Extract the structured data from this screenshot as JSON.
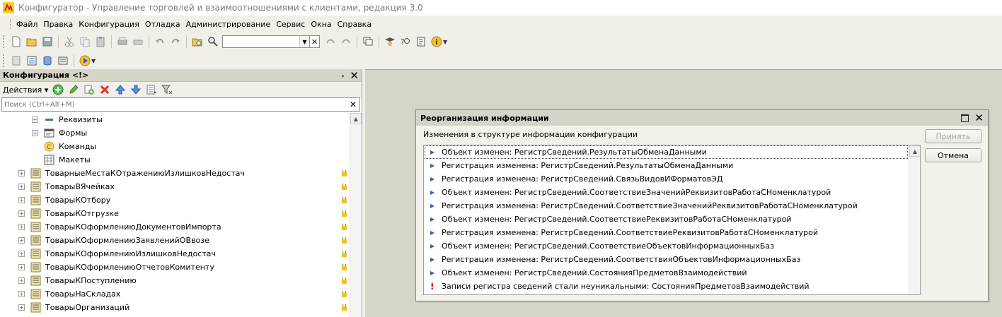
{
  "window": {
    "title": "Конфигуратор - Управление торговлей и взаимоотношениями с клиентами, редакция 3.0"
  },
  "menu": {
    "items": [
      "Файл",
      "Правка",
      "Конфигурация",
      "Отладка",
      "Администрирование",
      "Сервис",
      "Окна",
      "Справка"
    ]
  },
  "config_panel": {
    "title": "Конфигурация <!>",
    "actions_label": "Действия",
    "search_placeholder": "Поиск (Ctrl+Alt+M)",
    "tree": [
      {
        "label": "Реквизиты",
        "icon": "attribute-icon",
        "level": 1,
        "expandable": true
      },
      {
        "label": "Формы",
        "icon": "form-icon",
        "level": 1,
        "expandable": true
      },
      {
        "label": "Команды",
        "icon": "command-icon",
        "level": 1,
        "expandable": false
      },
      {
        "label": "Макеты",
        "icon": "template-icon",
        "level": 1,
        "expandable": false
      },
      {
        "label": "ТоварныеМестаКОтражениюИзлишковНедостач",
        "icon": "register-icon",
        "level": 0,
        "expandable": true,
        "locked": true
      },
      {
        "label": "ТоварыВЯчейках",
        "icon": "register-icon",
        "level": 0,
        "expandable": true,
        "locked": true
      },
      {
        "label": "ТоварыКОтбору",
        "icon": "register-icon",
        "level": 0,
        "expandable": true,
        "locked": true
      },
      {
        "label": "ТоварыКОтгрузке",
        "icon": "register-icon",
        "level": 0,
        "expandable": true,
        "locked": true
      },
      {
        "label": "ТоварыКОформлениюДокументовИмпорта",
        "icon": "register-icon",
        "level": 0,
        "expandable": true,
        "locked": true
      },
      {
        "label": "ТоварыКОформлениюЗаявленийОВвозе",
        "icon": "register-icon",
        "level": 0,
        "expandable": true,
        "locked": true
      },
      {
        "label": "ТоварыКОформлениюИзлишковНедостач",
        "icon": "register-icon",
        "level": 0,
        "expandable": true,
        "locked": true
      },
      {
        "label": "ТоварыКОформлениюОтчетовКомитенту",
        "icon": "register-icon",
        "level": 0,
        "expandable": true,
        "locked": true
      },
      {
        "label": "ТоварыКПоступлению",
        "icon": "register-icon",
        "level": 0,
        "expandable": true,
        "locked": true
      },
      {
        "label": "ТоварыНаСкладах",
        "icon": "register-icon",
        "level": 0,
        "expandable": true,
        "locked": true
      },
      {
        "label": "ТоварыОрганизаций",
        "icon": "register-icon",
        "level": 0,
        "expandable": true,
        "locked": true
      }
    ]
  },
  "dialog": {
    "title": "Реорганизация информации",
    "subtitle": "Изменения в структуре информации конфигурации",
    "accept_label": "Принять",
    "cancel_label": "Отмена",
    "accept_enabled": false,
    "changes": [
      {
        "text": "Объект изменен: РегистрСведений.РезультатыОбменаДанными",
        "kind": "change"
      },
      {
        "text": "Регистрация изменена: РегистрСведений.РезультатыОбменаДанными",
        "kind": "change"
      },
      {
        "text": "Регистрация изменена: РегистрСведений.СвязьВидовИФорматовЭД",
        "kind": "change"
      },
      {
        "text": "Объект изменен: РегистрСведений.СоответствиеЗначенийРеквизитовРаботаСНоменклатурой",
        "kind": "change"
      },
      {
        "text": "Регистрация изменена: РегистрСведений.СоответствиеЗначенийРеквизитовРаботаСНоменклатурой",
        "kind": "change"
      },
      {
        "text": "Объект изменен: РегистрСведений.СоответствиеРеквизитовРаботаСНоменклатурой",
        "kind": "change"
      },
      {
        "text": "Регистрация изменена: РегистрСведений.СоответствиеРеквизитовРаботаСНоменклатурой",
        "kind": "change"
      },
      {
        "text": "Объект изменен: РегистрСведений.СоответствиеОбъектовИнформационныхБаз",
        "kind": "change"
      },
      {
        "text": "Регистрация изменена: РегистрСведений.СоответствияОбъектовИнформационныхБаз",
        "kind": "change"
      },
      {
        "text": "Объект изменен: РегистрСведений.СостоянияПредметовВзаимодействий",
        "kind": "change"
      },
      {
        "text": "Записи регистра сведений стали неуникальными: СостоянияПредметовВзаимодействий",
        "kind": "warning"
      }
    ]
  }
}
